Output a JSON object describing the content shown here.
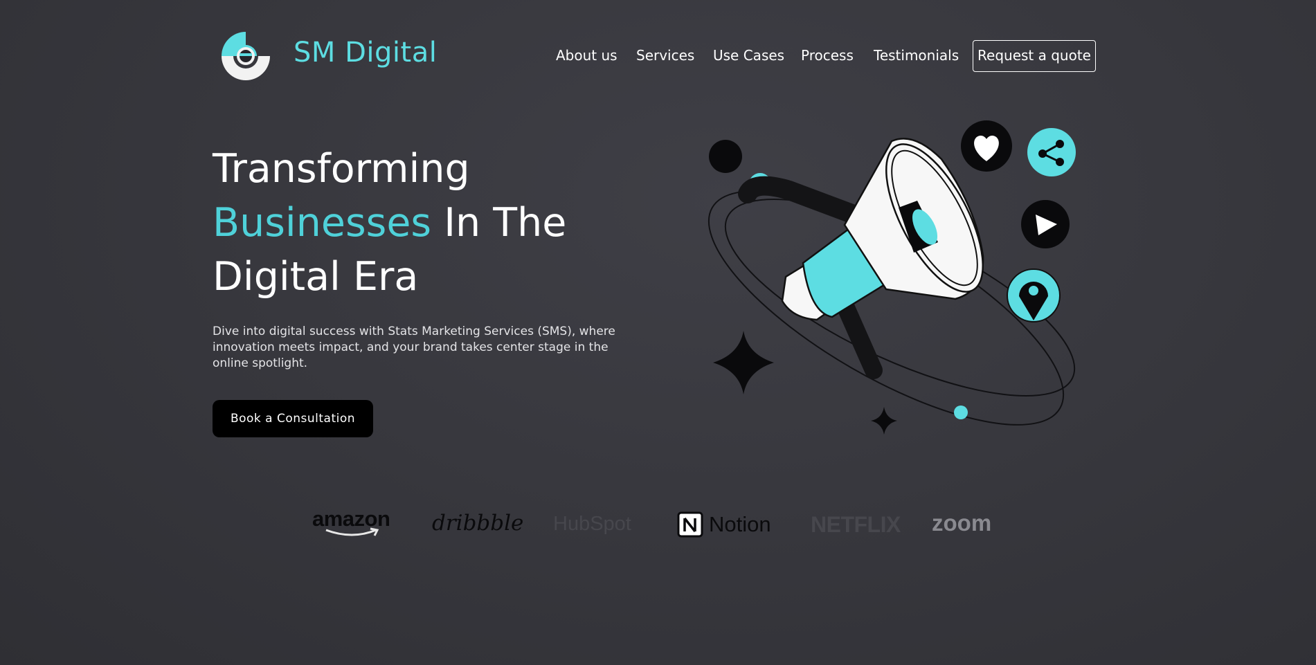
{
  "header": {
    "brand_name": "SM Digital",
    "nav": [
      "About us",
      "Services",
      "Use Cases",
      "Process",
      "Testimonials"
    ],
    "quote_button": "Request a quote"
  },
  "hero": {
    "title_line1": "Transforming",
    "title_accent": "Businesses",
    "title_rest_line2": " In The",
    "title_line3": "Digital Era",
    "description": "Dive into digital success with Stats Marketing Services (SMS), where innovation meets impact, and your brand takes center stage in the online spotlight.",
    "cta_label": "Book a Consultation"
  },
  "illustration_icons": [
    "megaphone-icon",
    "heart-icon",
    "share-icon",
    "play-icon",
    "location-pin-icon",
    "sparkle-icon"
  ],
  "partners": {
    "amazon": "amazon",
    "dribbble": "dribbble",
    "hubspot": "HubSpot",
    "notion": "Notion",
    "netflix": "NETFLIX",
    "zoom": "zoom"
  },
  "colors": {
    "background": "#3a3a40",
    "accent": "#5ddde2",
    "dark": "#000000",
    "text": "#ffffff"
  }
}
